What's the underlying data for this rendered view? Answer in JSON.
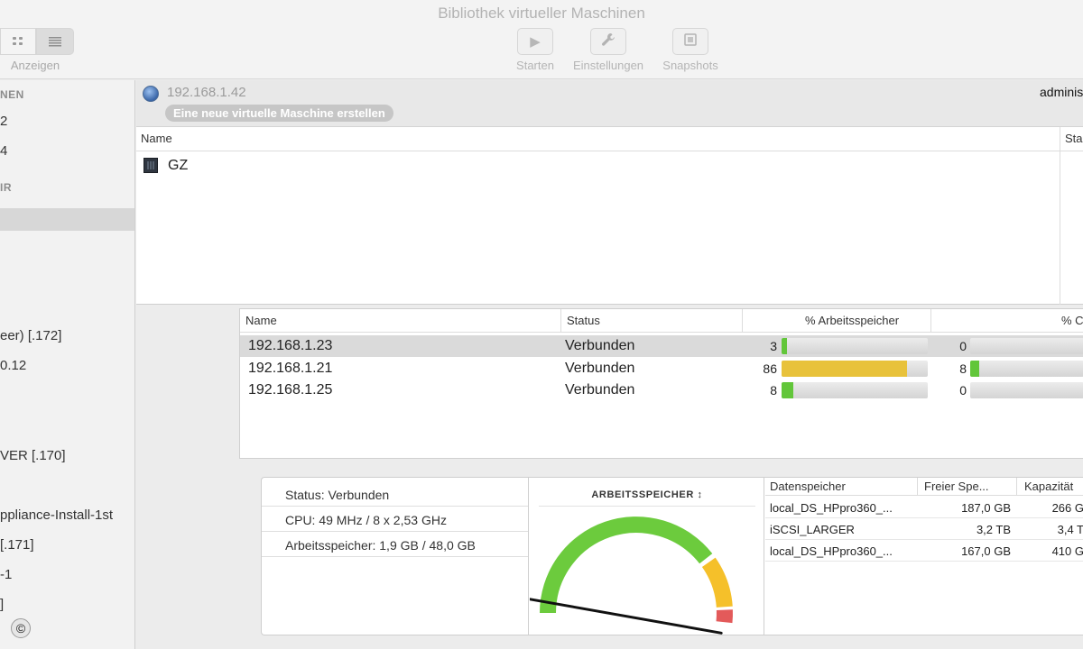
{
  "window": {
    "title": "Bibliothek virtueller Maschinen"
  },
  "toolbar": {
    "view_label": "Anzeigen",
    "start_label": "Starten",
    "settings_label": "Einstellungen",
    "snapshots_label": "Snapshots"
  },
  "sidebar": {
    "items": [
      {
        "text": "NEN",
        "kind": "header"
      },
      {
        "text": "2",
        "kind": "item"
      },
      {
        "text": "4",
        "kind": "item"
      },
      {
        "text": "IR",
        "kind": "header"
      },
      {
        "text": "",
        "kind": "selected"
      },
      {
        "text": "eer) [.172]",
        "kind": "item"
      },
      {
        "text": "0.12",
        "kind": "item"
      },
      {
        "text": "VER [.170]",
        "kind": "item"
      },
      {
        "text": "ppliance-Install-1st",
        "kind": "item"
      },
      {
        "text": "[.171]",
        "kind": "item"
      },
      {
        "text": "-1",
        "kind": "item"
      },
      {
        "text": "]",
        "kind": "item"
      }
    ],
    "copyright_symbol": "©"
  },
  "host": {
    "ip": "192.168.1.42",
    "new_vm_button": "Eine neue virtuelle Maschine erstellen",
    "user": "adminis"
  },
  "vm_table": {
    "col_name": "Name",
    "col_status": "Sta",
    "rows": [
      {
        "name": "GZ"
      }
    ]
  },
  "hosts_table": {
    "col_name": "Name",
    "col_status": "Status",
    "col_memory": "% Arbeitsspeicher",
    "col_cpu": "% C",
    "rows": [
      {
        "name": "192.168.1.23",
        "status": "Verbunden",
        "memory_pct": 3,
        "cpu_pct": 0,
        "selected": true
      },
      {
        "name": "192.168.1.21",
        "status": "Verbunden",
        "memory_pct": 86,
        "cpu_pct": 8,
        "selected": false
      },
      {
        "name": "192.168.1.25",
        "status": "Verbunden",
        "memory_pct": 8,
        "cpu_pct": 0,
        "selected": false
      }
    ]
  },
  "details": {
    "status": "Status:  Verbunden",
    "cpu": "CPU: 49 MHz / 8 x 2,53 GHz",
    "memory": "Arbeitsspeicher: 1,9 GB / 48,0 GB"
  },
  "gauge": {
    "title": "ARBEITSSPEICHER ↕",
    "value_fraction": 0.04,
    "colors": {
      "green": "#6ccb3d",
      "yellow": "#f5c02a",
      "red": "#e35a5a"
    }
  },
  "datastores": {
    "col_name": "Datenspeicher",
    "col_free": "Freier Spe...",
    "col_capacity": "Kapazität",
    "rows": [
      {
        "name": "local_DS_HPpro360_...",
        "free": "187,0 GB",
        "capacity": "266 G"
      },
      {
        "name": "iSCSI_LARGER",
        "free": "3,2 TB",
        "capacity": "3,4 T"
      },
      {
        "name": "local_DS_HPpro360_...",
        "free": "167,0 GB",
        "capacity": "410 G"
      }
    ]
  },
  "bar_colors": {
    "low": "#62c63a",
    "high": "#e8c23b"
  }
}
